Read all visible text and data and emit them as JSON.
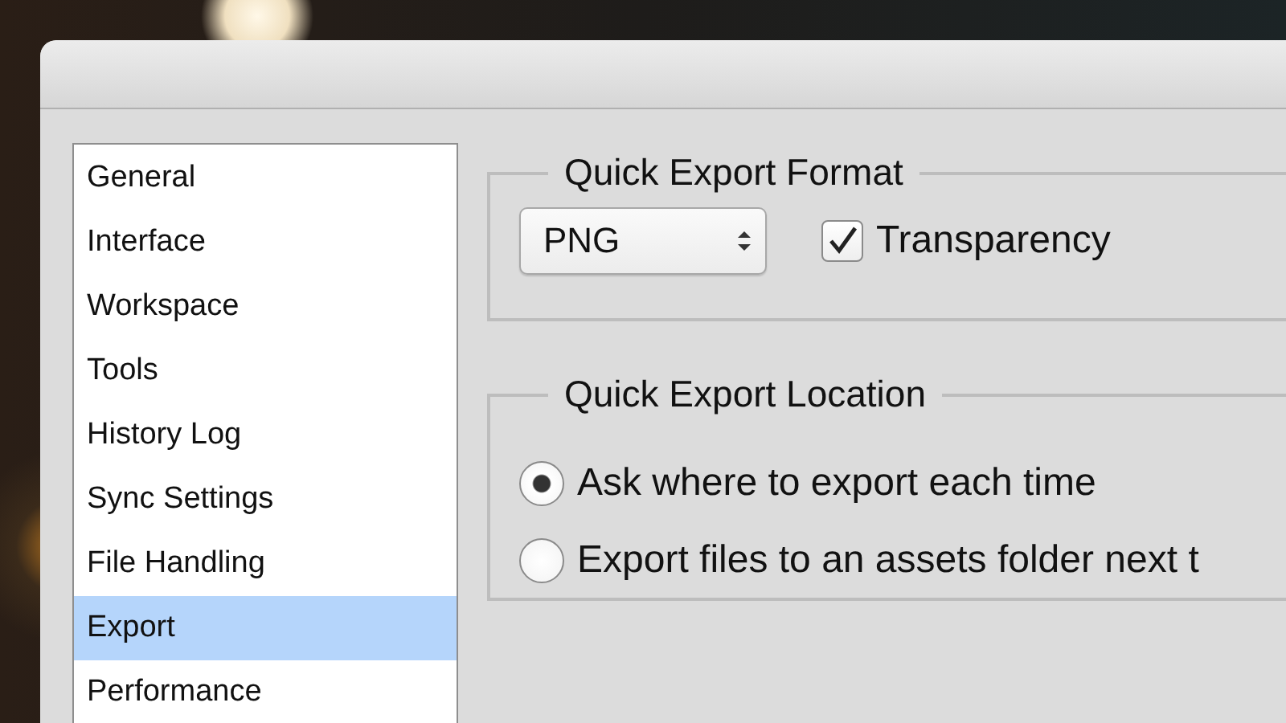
{
  "sidebar": {
    "items": [
      {
        "label": "General",
        "selected": false
      },
      {
        "label": "Interface",
        "selected": false
      },
      {
        "label": "Workspace",
        "selected": false
      },
      {
        "label": "Tools",
        "selected": false
      },
      {
        "label": "History Log",
        "selected": false
      },
      {
        "label": "Sync Settings",
        "selected": false
      },
      {
        "label": "File Handling",
        "selected": false
      },
      {
        "label": "Export",
        "selected": true
      },
      {
        "label": "Performance",
        "selected": false
      }
    ]
  },
  "format_group": {
    "title": "Quick Export Format",
    "format": "PNG",
    "transparency": {
      "label": "Transparency",
      "checked": true
    }
  },
  "location_group": {
    "title": "Quick Export Location",
    "options": [
      {
        "label": "Ask where to export each time",
        "selected": true
      },
      {
        "label": "Export files to an assets folder next t",
        "selected": false
      }
    ]
  }
}
